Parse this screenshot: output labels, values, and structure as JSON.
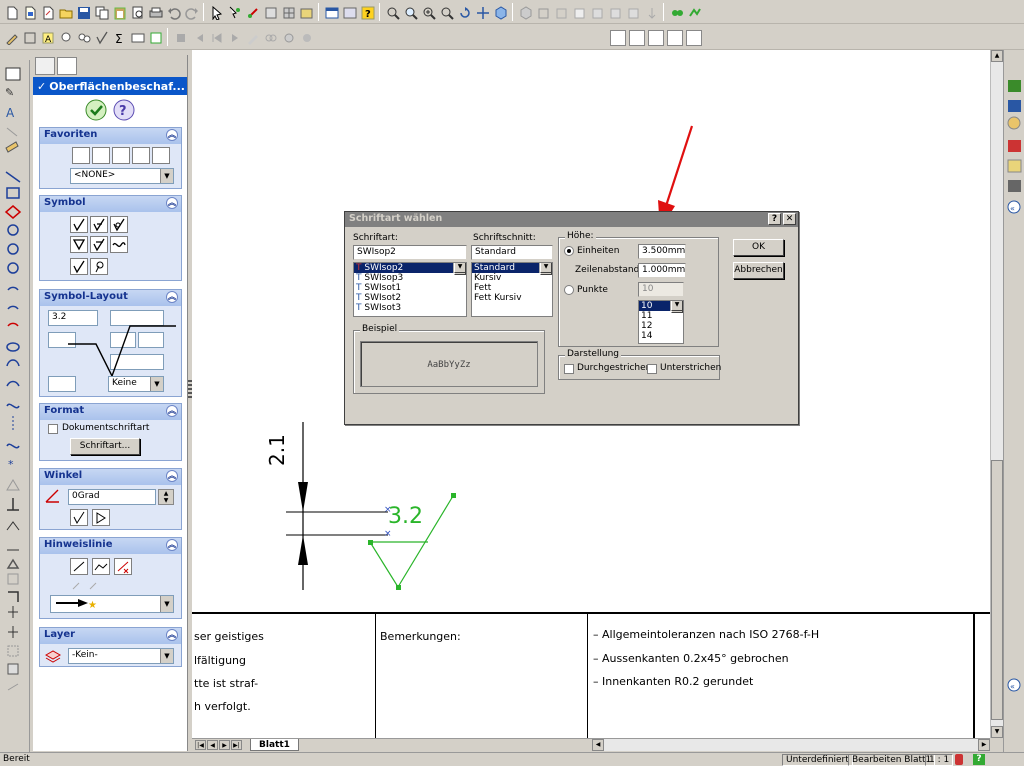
{
  "property_manager": {
    "title": "Oberflächenbeschaf...",
    "groups": {
      "favoriten": {
        "label": "Favoriten",
        "combo_value": "<NONE>"
      },
      "symbol": {
        "label": "Symbol"
      },
      "symbol_layout": {
        "label": "Symbol-Layout",
        "value_top_left": "3.2",
        "keine_value": "Keine"
      },
      "format": {
        "label": "Format",
        "checkbox_label": "Dokumentschriftart",
        "button_label": "Schriftart..."
      },
      "winkel": {
        "label": "Winkel",
        "value": "0Grad"
      },
      "hinweislinie": {
        "label": "Hinweislinie"
      },
      "layer": {
        "label": "Layer",
        "value": "-Kein-"
      }
    }
  },
  "dialog": {
    "title": "Schriftart wählen",
    "help_btn": "?",
    "close_btn": "✕",
    "font_label": "Schriftart:",
    "font_value": "SWIsop2",
    "font_list": [
      "SWIsop2",
      "SWIsop3",
      "SWIsot1",
      "SWIsot2",
      "SWIsot3"
    ],
    "style_label": "Schriftschnitt:",
    "style_value": "Standard",
    "style_list": [
      "Standard",
      "Kursiv",
      "Fett",
      "Fett Kursiv"
    ],
    "height_label": "Höhe:",
    "units_label": "Einheiten",
    "units_value": "3.500mm",
    "spacing_label": "Zeilenabstand:",
    "spacing_value": "1.000mm",
    "points_label": "Punkte",
    "points_value": "10",
    "points_list": [
      "10",
      "11",
      "12",
      "14"
    ],
    "sample_label": "Beispiel",
    "sample_text": "AaBbYyZz",
    "display_label": "Darstellung",
    "strike_label": "Durchgestrichen",
    "underline_label": "Unterstrichen",
    "ok_label": "OK",
    "cancel_label": "Abbrechen"
  },
  "drawing": {
    "dimension_text": "2.1",
    "symbol_value": "3.2",
    "title_block": {
      "left_lines": [
        "ser geistiges",
        "lfältigung",
        "tte ist straf-",
        "h verfolgt."
      ],
      "remarks_label": "Bemerkungen:",
      "notes": [
        "– Allgemeintoleranzen nach ISO 2768-f-H",
        "– Aussenkanten 0.2x45° gebrochen",
        "– Innenkanten R0.2 gerundet"
      ]
    },
    "sheet_tab": "Blatt1"
  },
  "status_bar": {
    "left": "Bereit",
    "state": "Unterdefiniert",
    "mode": "Bearbeiten Blatt1",
    "scale": "1 : 1",
    "help_icon": "?"
  },
  "colors": {
    "accent": "#0a56c9",
    "symbol_green": "#2ab52a",
    "arrow_red": "#e01010",
    "selection": "#0a246a"
  }
}
